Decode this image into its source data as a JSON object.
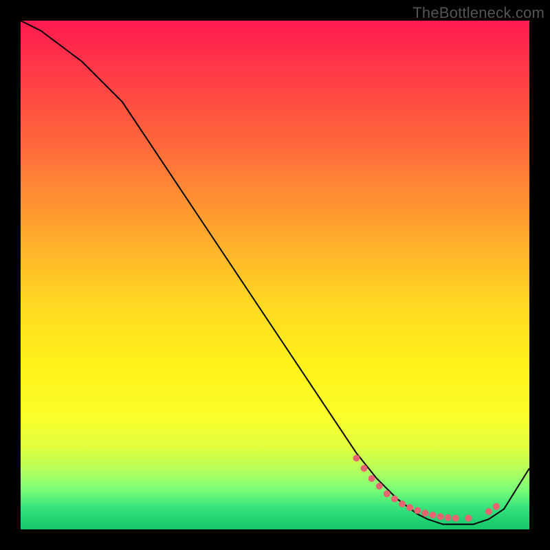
{
  "watermark": "TheBottleneck.com",
  "chart_data": {
    "type": "line",
    "title": "",
    "xlabel": "",
    "ylabel": "",
    "xlim": [
      0,
      100
    ],
    "ylim": [
      0,
      100
    ],
    "grid": false,
    "legend": false,
    "series": [
      {
        "name": "curve",
        "stroke": "#000000",
        "x": [
          0,
          4,
          8,
          12,
          16,
          20,
          28,
          36,
          44,
          52,
          60,
          66,
          70,
          74,
          78,
          80,
          83,
          86,
          89,
          92,
          95,
          100
        ],
        "y": [
          100,
          98,
          95,
          92,
          88,
          84,
          72,
          60,
          48,
          36,
          24,
          15,
          10,
          6,
          3,
          2,
          1,
          1,
          1,
          2,
          4,
          12
        ]
      }
    ],
    "markers": {
      "name": "dots",
      "color": "#e86470",
      "radius": 5,
      "x": [
        66,
        67.5,
        69,
        70.5,
        72,
        73.5,
        75,
        76.5,
        78,
        79.5,
        81,
        82.5,
        84,
        85.5,
        88,
        92,
        93.5
      ],
      "y": [
        14,
        12,
        10,
        8.5,
        7,
        6,
        5,
        4.3,
        3.7,
        3.2,
        2.8,
        2.5,
        2.3,
        2.2,
        2.2,
        3.5,
        4.5
      ]
    }
  }
}
